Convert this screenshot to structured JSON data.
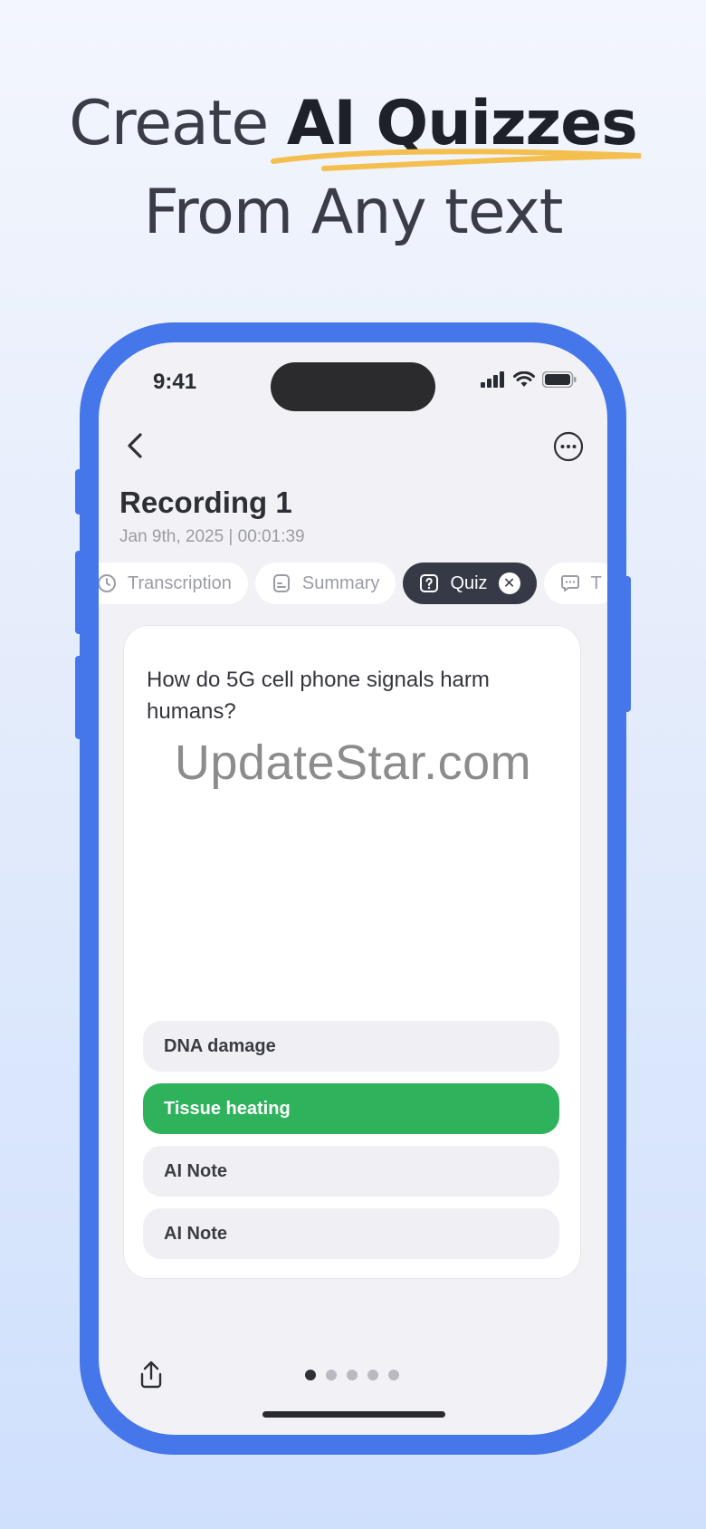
{
  "headline": {
    "line1_prefix": "Create ",
    "line1_strong": "AI Quizzes",
    "line2": "From Any text"
  },
  "status_bar": {
    "time": "9:41"
  },
  "recording": {
    "title": "Recording 1",
    "meta": "Jan 9th, 2025 | 00:01:39"
  },
  "tabs": [
    {
      "label": "Transcription",
      "icon": "clock-icon"
    },
    {
      "label": "Summary",
      "icon": "document-icon"
    },
    {
      "label": "Quiz",
      "icon": "quiz-icon",
      "active": true
    },
    {
      "label": "T",
      "icon": "chat-icon"
    }
  ],
  "quiz": {
    "question": "How do 5G cell phone signals harm humans?",
    "options": [
      {
        "label": "DNA damage",
        "correct": false
      },
      {
        "label": "Tissue heating",
        "correct": true
      },
      {
        "label": "AI Note",
        "correct": false
      },
      {
        "label": "AI Note",
        "correct": false
      }
    ]
  },
  "watermark": "UpdateStar.com",
  "pagination": {
    "total": 5,
    "current": 1
  },
  "colors": {
    "phone_frame": "#4576ea",
    "accent_underline": "#f4bf4f",
    "correct_option": "#2eb35c",
    "active_tab": "#353a46"
  }
}
